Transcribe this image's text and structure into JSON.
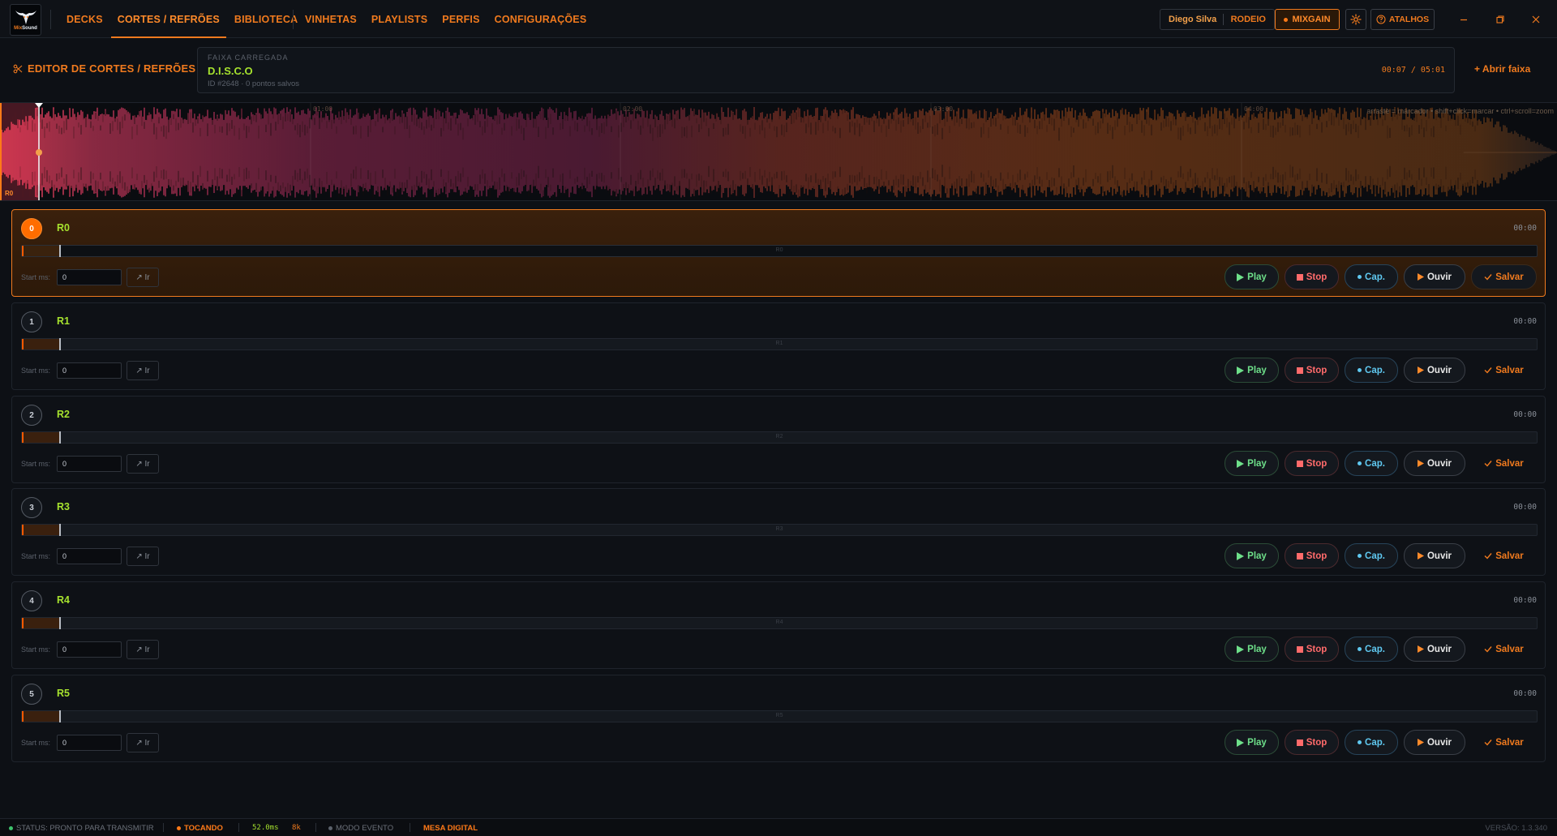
{
  "app": {
    "logo_text_a": "Mix",
    "logo_text_b": "Sound"
  },
  "nav": {
    "items": [
      "DECKS",
      "CORTES / REFRÕES",
      "BIBLIOTECA",
      "VINHETAS",
      "PLAYLISTS",
      "PERFIS",
      "CONFIGURAÇÕES"
    ],
    "active": "CORTES / REFRÕES"
  },
  "header": {
    "user_name": "Diego Silva",
    "mode": "RODEIO",
    "mixgain_label": "MIXGAIN",
    "shortcuts_label": "ATALHOS"
  },
  "editor": {
    "title": "EDITOR DE CORTES / REFRÕES",
    "track_label": "FAIXA CARREGADA",
    "track_name": "D.I.S.C.O",
    "track_meta": "ID #2648 · 0 pontos salvos",
    "time": "00:07 / 05:01",
    "open_track": "+ Abrir faixa"
  },
  "waveform": {
    "hint": "arraste = marcador • shift+click=marcar • ctrl+scroll=zoom",
    "marker_label": "R0",
    "tick_labels": [
      "01:00",
      "02:00",
      "03:00",
      "04:00"
    ],
    "playhead_fraction": 0.025
  },
  "cuts": [
    {
      "index": "0",
      "name": "R0",
      "time": "00:00",
      "bar_label": "R0",
      "start_label": "Start ms:",
      "start_value": "0",
      "go_label": "↗ Ir",
      "active": true
    },
    {
      "index": "1",
      "name": "R1",
      "time": "00:00",
      "bar_label": "R1",
      "start_label": "Start ms:",
      "start_value": "0",
      "go_label": "↗ Ir",
      "active": false
    },
    {
      "index": "2",
      "name": "R2",
      "time": "00:00",
      "bar_label": "R2",
      "start_label": "Start ms:",
      "start_value": "0",
      "go_label": "↗ Ir",
      "active": false
    },
    {
      "index": "3",
      "name": "R3",
      "time": "00:00",
      "bar_label": "R3",
      "start_label": "Start ms:",
      "start_value": "0",
      "go_label": "↗ Ir",
      "active": false
    },
    {
      "index": "4",
      "name": "R4",
      "time": "00:00",
      "bar_label": "R4",
      "start_label": "Start ms:",
      "start_value": "0",
      "go_label": "↗ Ir",
      "active": false
    },
    {
      "index": "5",
      "name": "R5",
      "time": "00:00",
      "bar_label": "R5",
      "start_label": "Start ms:",
      "start_value": "0",
      "go_label": "↗ Ir",
      "active": false
    }
  ],
  "actions": {
    "play": "Play",
    "stop": "Stop",
    "cap": "Cap.",
    "ouvir": "Ouvir",
    "salvar": "Salvar"
  },
  "status": {
    "ready": "STATUS: PRONTO PARA TRANSMITIR",
    "playing": "TOCANDO",
    "latency": "52.0ms",
    "bits": "8k",
    "event_mode": "MODO EVENTO",
    "digital": "MESA DIGITAL",
    "version": "VERSÃO: 1.3.340"
  },
  "colors": {
    "accent": "#f07a1e",
    "green": "#a6e22e",
    "play": "#6ee08a",
    "stop": "#ff6b6b",
    "cap": "#5fc8f0"
  }
}
